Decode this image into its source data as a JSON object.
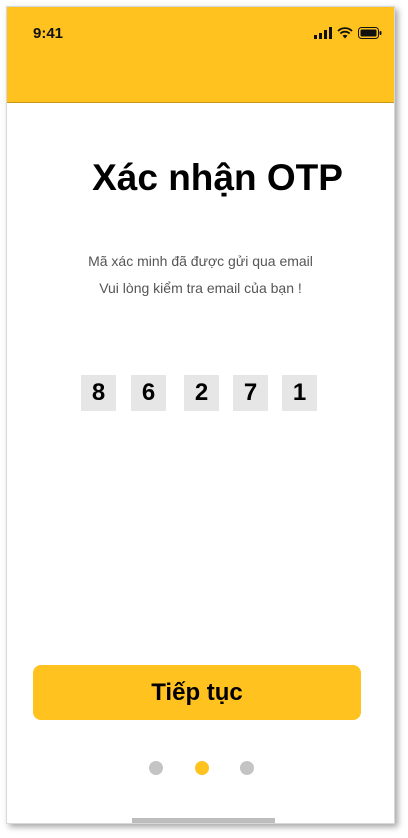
{
  "status_bar": {
    "time": "9:41",
    "icons": [
      "signal-icon",
      "wifi-icon",
      "battery-icon"
    ]
  },
  "colors": {
    "accent": "#FFC21F",
    "otp_box": "#E6E6E6",
    "dot_inactive": "#C4C4C4"
  },
  "screen": {
    "title": "Xác nhận OTP",
    "message_line1": "Mã xác minh đã được gửi qua email",
    "message_line2": "Vui lòng kiểm tra email của bạn !",
    "otp_digits": [
      "8",
      "6",
      "2",
      "7",
      "1"
    ],
    "continue_label": "Tiếp tục"
  },
  "pagination": {
    "total": 3,
    "active_index": 1
  }
}
